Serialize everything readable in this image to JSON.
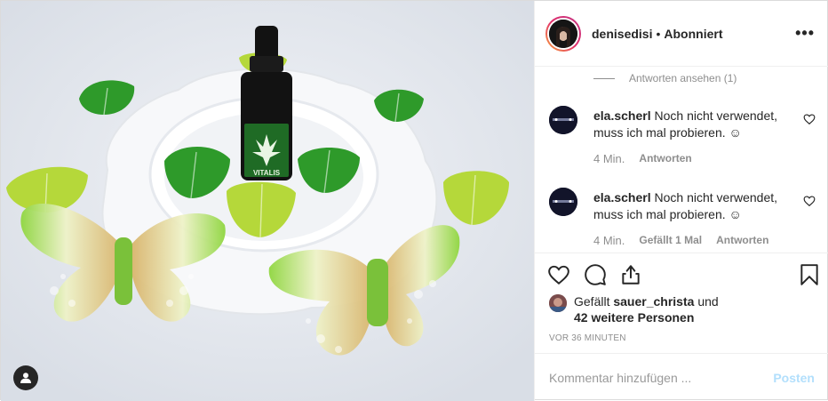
{
  "header": {
    "username": "denisedisi",
    "separator": "•",
    "follow_label": "Abonniert",
    "more_label": "•••"
  },
  "replies": {
    "label": "Antworten ansehen (1)"
  },
  "comments": [
    {
      "username": "ela.scherl",
      "text": "Noch nicht verwendet, muss ich mal probieren. ☺",
      "time": "4 Min.",
      "likes": "",
      "reply_label": "Antworten"
    },
    {
      "username": "ela.scherl",
      "text": "Noch nicht verwendet, muss ich mal probieren. ☺",
      "time": "4 Min.",
      "likes": "Gefällt 1 Mal",
      "reply_label": "Antworten"
    }
  ],
  "likes": {
    "prefix": "Gefällt",
    "user": "sauer_christa",
    "connector": "und",
    "others": "42 weitere Personen"
  },
  "timestamp": "VOR 36 MINUTEN",
  "comment_box": {
    "placeholder": "Kommentar hinzufügen ...",
    "post_label": "Posten"
  },
  "photo": {
    "bottle_label": "VITALIS",
    "colors": {
      "background": "#e4e8ee",
      "leaf_dark": "#2e9a2a",
      "leaf_light": "#b5d83a",
      "bottle": "#121212",
      "label_green": "#1f6b25"
    }
  },
  "icons": [
    "user-tag-icon",
    "more-options-icon",
    "heart-icon",
    "comment-icon",
    "share-icon",
    "bookmark-icon"
  ]
}
